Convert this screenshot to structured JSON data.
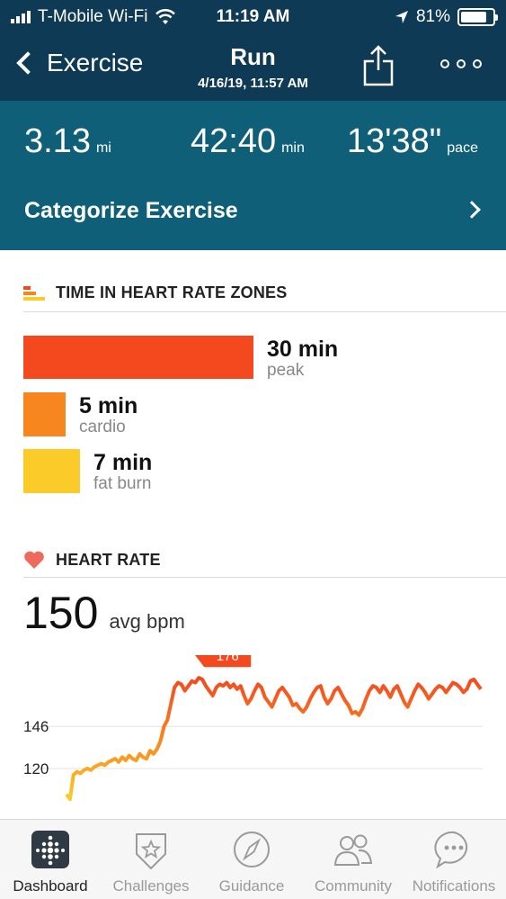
{
  "status_bar": {
    "carrier": "T-Mobile Wi-Fi",
    "time": "11:19 AM",
    "battery": "81%",
    "battery_level": 0.81
  },
  "nav": {
    "back_label": "Exercise",
    "title": "Run",
    "subtitle": "4/16/19, 11:57 AM"
  },
  "stats": {
    "distance_value": "3.13",
    "distance_unit": "mi",
    "duration_value": "42:40",
    "duration_unit": "min",
    "pace_value": "13'38\"",
    "pace_unit": "pace"
  },
  "categorize_label": "Categorize Exercise",
  "zones": {
    "title": "TIME IN HEART RATE ZONES",
    "items": [
      {
        "minutes_label": "30 min",
        "name": "peak",
        "minutes": 30,
        "color": "#f4491f"
      },
      {
        "minutes_label": "5 min",
        "name": "cardio",
        "minutes": 5,
        "color": "#f8861e"
      },
      {
        "minutes_label": "7 min",
        "name": "fat burn",
        "minutes": 7,
        "color": "#fbcb2a"
      }
    ]
  },
  "heart_rate": {
    "title": "HEART RATE",
    "avg_value": "150",
    "avg_label": "avg bpm",
    "peak_marker": "176"
  },
  "chart_data": {
    "type": "line",
    "title": "",
    "xlabel": "",
    "ylabel": "",
    "y_ticks": [
      146,
      120
    ],
    "peak_label": "176",
    "ylim": [
      90,
      190
    ],
    "series": [
      {
        "values": [
          104,
          101,
          116,
          118,
          117,
          119,
          120,
          119,
          121,
          122,
          123,
          122,
          124,
          125,
          126,
          124,
          127,
          125,
          128,
          126,
          125,
          129,
          127,
          126,
          131,
          129,
          132,
          137,
          146,
          150,
          160,
          170,
          173,
          172,
          168,
          171,
          174,
          173,
          176,
          175,
          171,
          168,
          165,
          170,
          172,
          171,
          173,
          170,
          172,
          169,
          171,
          165,
          160,
          163,
          168,
          172,
          170,
          164,
          161,
          158,
          163,
          168,
          170,
          167,
          164,
          159,
          160,
          157,
          155,
          158,
          163,
          167,
          170,
          171,
          164,
          160,
          163,
          168,
          170,
          166,
          162,
          159,
          154,
          155,
          153,
          157,
          163,
          168,
          171,
          170,
          167,
          171,
          168,
          164,
          169,
          171,
          166,
          161,
          158,
          163,
          168,
          172,
          170,
          167,
          163,
          166,
          169,
          171,
          170,
          167,
          170,
          173,
          172,
          170,
          167,
          169,
          174,
          175,
          172,
          169
        ]
      }
    ],
    "gradient_colors": [
      "#fbcb2a",
      "#f8861e",
      "#f4491f"
    ]
  },
  "tabs": [
    {
      "label": "Dashboard",
      "icon": "dashboard-icon",
      "active": true
    },
    {
      "label": "Challenges",
      "icon": "challenges-star-badge-icon",
      "active": false
    },
    {
      "label": "Guidance",
      "icon": "compass-icon",
      "active": false
    },
    {
      "label": "Community",
      "icon": "people-icon",
      "active": false
    },
    {
      "label": "Notifications",
      "icon": "chat-bubble-icon",
      "active": false
    }
  ]
}
